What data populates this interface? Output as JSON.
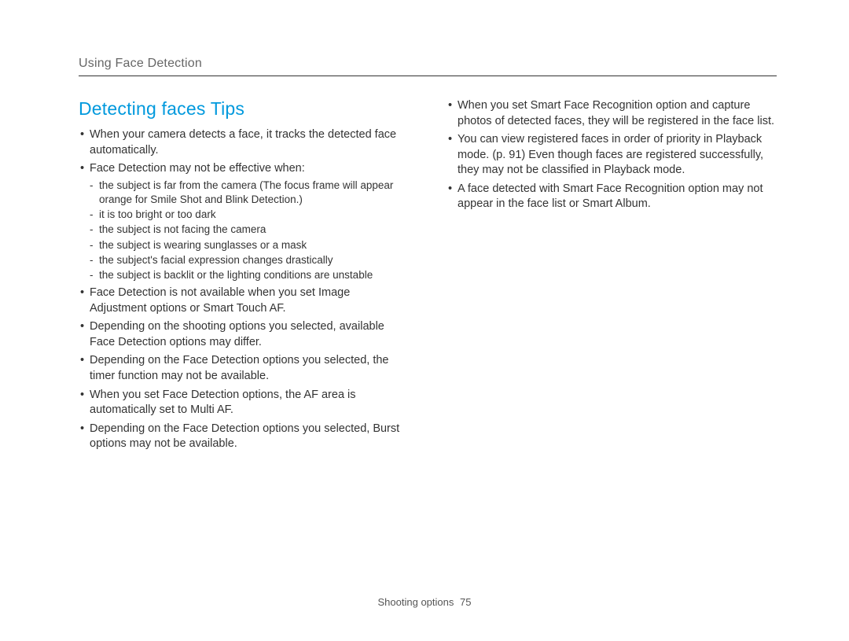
{
  "section_label": "Using Face Detection",
  "heading": "Detecting faces Tips",
  "left_bullets": [
    {
      "text": "When your camera detects a face, it tracks the detected face automatically."
    },
    {
      "text": "Face Detection may not be effective when:",
      "sub": [
        "the subject is far from the camera (The focus frame will appear orange for Smile Shot and Blink Detection.)",
        "it is too bright or too dark",
        "the subject is not facing the camera",
        "the subject is wearing sunglasses or a mask",
        "the subject's facial expression changes drastically",
        "the subject is backlit or the lighting conditions are unstable"
      ]
    },
    {
      "text": "Face Detection is not available when you set Image Adjustment options or Smart Touch AF."
    },
    {
      "text": "Depending on the shooting options you selected, available Face Detection options may differ."
    },
    {
      "text": "Depending on the Face Detection options you selected, the timer function may not be available."
    },
    {
      "text": "When you set Face Detection options, the AF area is automatically set to Multi AF."
    },
    {
      "text": "Depending on the Face Detection options you selected, Burst options may not be available."
    }
  ],
  "right_bullets": [
    {
      "text": "When you set Smart Face Recognition option and capture photos of detected faces, they will be registered in the face list."
    },
    {
      "text": "You can view registered faces in order of priority in Playback mode. (p. 91) Even though faces are registered successfully, they may not be classified in Playback mode."
    },
    {
      "text": "A face detected with Smart Face Recognition option may not appear in the face list or Smart Album."
    }
  ],
  "footer_label": "Shooting options",
  "footer_page": "75"
}
